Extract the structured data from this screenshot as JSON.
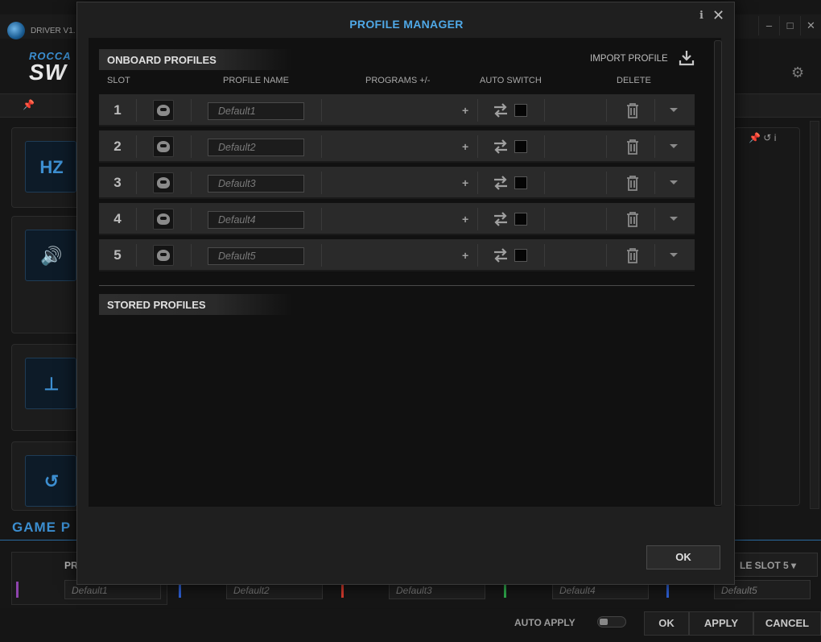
{
  "background": {
    "driver_label": "DRIVER V1.",
    "brand_top": "ROCCA",
    "brand_bottom": "SW",
    "game_label": "GAME P",
    "profile_card_label": "PR",
    "profile_slot_select": "LE SLOT 5",
    "slots": [
      "Default1",
      "Default2",
      "Default3",
      "Default4",
      "Default5"
    ],
    "slot_colors": [
      "#8e44ad",
      "#2d5fd3",
      "#d33a2d",
      "#2ea84a",
      "#2d5fd3"
    ],
    "auto_apply_label": "AUTO APPLY",
    "buttons": {
      "ok": "OK",
      "apply": "APPLY",
      "cancel": "CANCEL"
    },
    "tile_icons": [
      "hz-icon",
      "speaker-icon",
      "distance-icon",
      "reset-icon"
    ]
  },
  "dialog": {
    "title": "PROFILE MANAGER",
    "info_glyph": "i",
    "close_glyph": "✕",
    "onboard_title": "ONBOARD PROFILES",
    "import_label": "IMPORT PROFILE",
    "columns": {
      "slot": "SLOT",
      "profile_name": "PROFILE NAME",
      "programs": "PROGRAMS +/-",
      "auto_switch": "AUTO SWITCH",
      "delete": "DELETE"
    },
    "profiles": [
      {
        "slot": "1",
        "name": "Default1"
      },
      {
        "slot": "2",
        "name": "Default2"
      },
      {
        "slot": "3",
        "name": "Default3"
      },
      {
        "slot": "4",
        "name": "Default4"
      },
      {
        "slot": "5",
        "name": "Default5"
      }
    ],
    "plus_glyph": "+",
    "stored_title": "STORED PROFILES",
    "ok_label": "OK",
    "accent_color": "#4fa8e6"
  }
}
